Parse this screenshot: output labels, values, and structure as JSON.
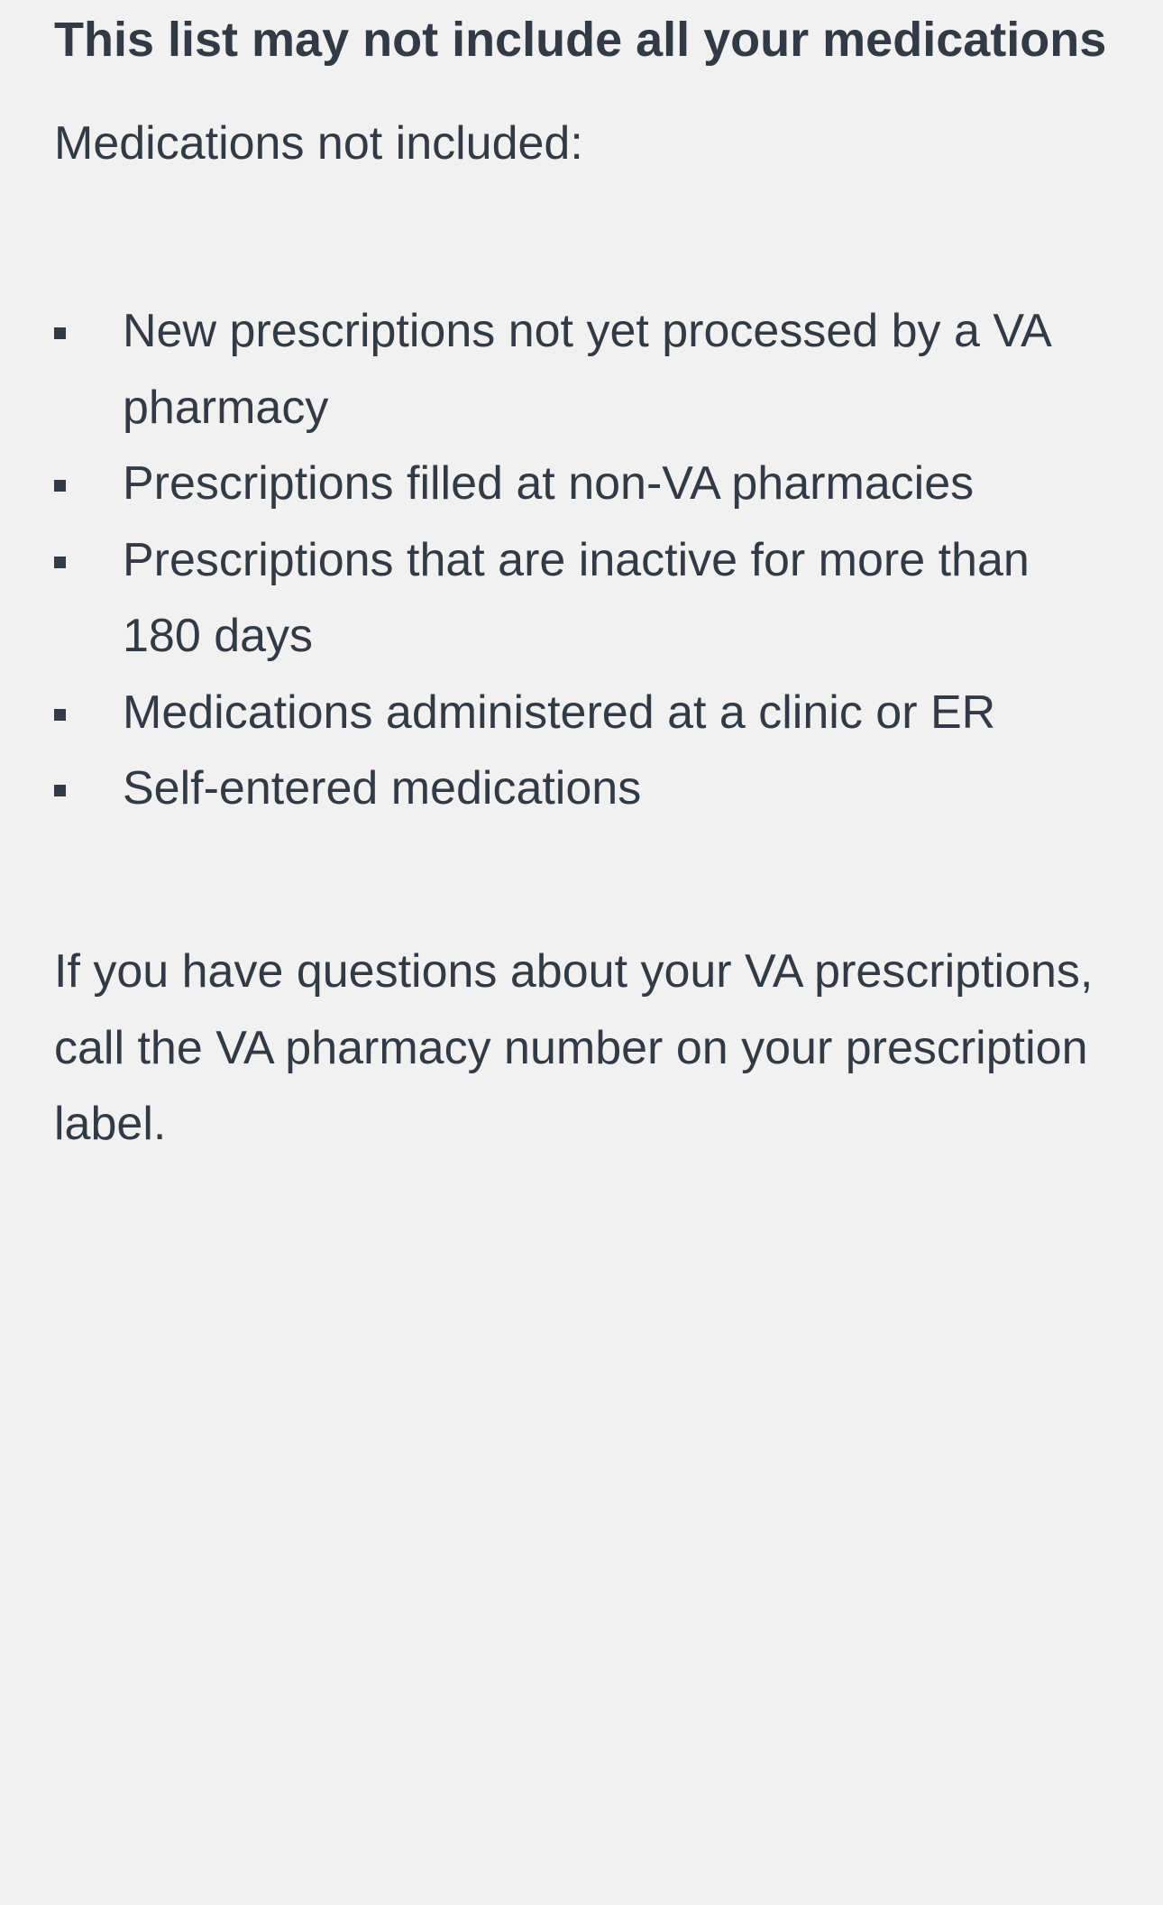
{
  "notice": {
    "heading": "This list may not include all your medications",
    "intro": "Medications not included:",
    "items": [
      "New prescriptions not yet processed by a VA pharmacy",
      "Prescriptions filled at non-VA pharmacies",
      "Prescriptions that are inactive for more than 180 days",
      "Medications administered at a clinic or ER",
      "Self-entered medications"
    ],
    "footer": "If you have questions about your VA prescriptions, call the VA pharmacy number on your prescription label."
  },
  "colors": {
    "background": "#f1f1f1",
    "text": "#323a45"
  }
}
